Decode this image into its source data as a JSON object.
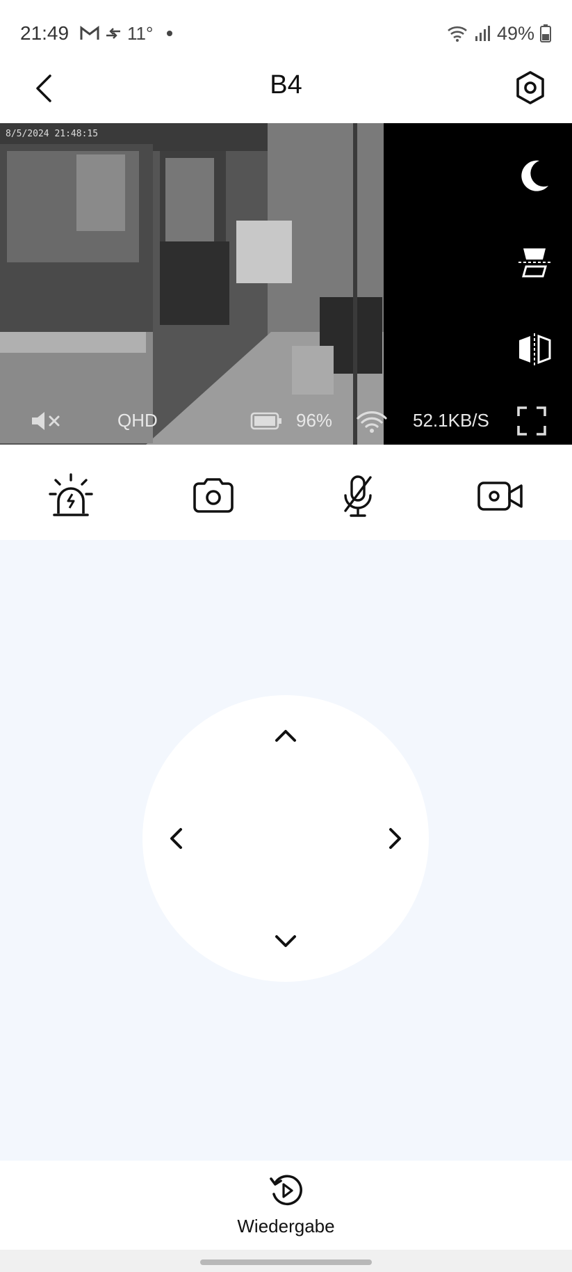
{
  "status_bar": {
    "time": "21:49",
    "temperature": "11°",
    "battery": "49%"
  },
  "header": {
    "title": "B4"
  },
  "video": {
    "timestamp": "8/5/2024 21:48:15",
    "quality": "QHD",
    "battery_percent": "96%",
    "bitrate": "52.1KB/S",
    "side_controls": [
      "moon-icon",
      "flip-vertical-icon",
      "mirror-icon"
    ]
  },
  "actions": [
    "siren-icon",
    "camera-icon",
    "microphone-muted-icon",
    "video-record-icon"
  ],
  "bottom": {
    "playback_label": "Wiedergabe"
  }
}
